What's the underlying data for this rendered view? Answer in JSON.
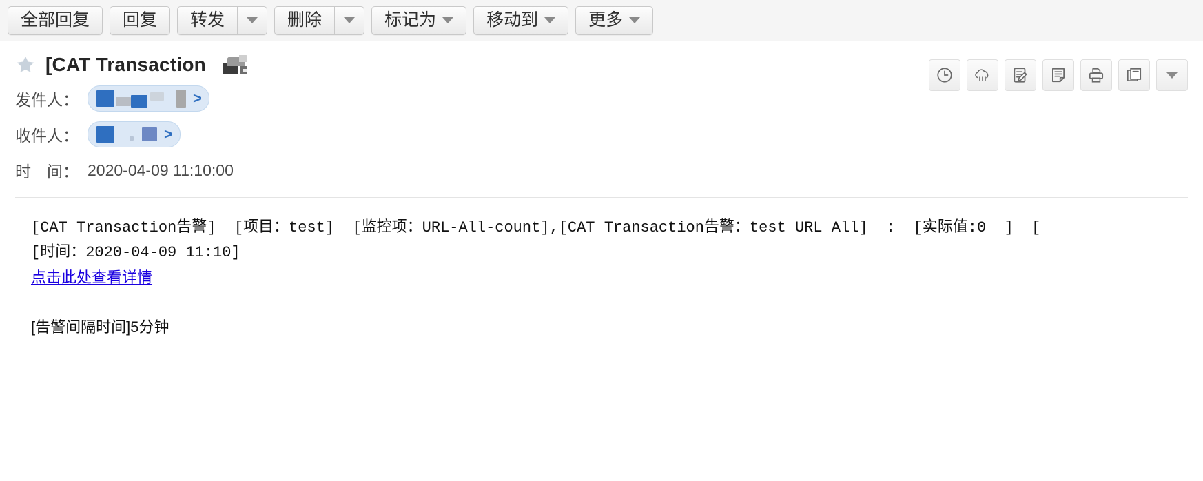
{
  "toolbar": {
    "buttons": [
      {
        "label": "全部回复",
        "has_caret": false,
        "split": false
      },
      {
        "label": "回复",
        "has_caret": false,
        "split": false
      },
      {
        "label": "转发",
        "has_caret": false,
        "split": true
      },
      {
        "label": "删除",
        "has_caret": false,
        "split": true
      },
      {
        "label": "标记为",
        "has_caret": true,
        "split": false
      },
      {
        "label": "移动到",
        "has_caret": true,
        "split": false
      },
      {
        "label": "更多",
        "has_caret": true,
        "split": false
      }
    ]
  },
  "mail": {
    "star_icon": "star-icon",
    "subject": "[CAT Transaction",
    "subject_redacted_image": "redacted-image",
    "from_label": "发件人：",
    "to_label": "收件人：",
    "time_label": "时　间：",
    "time_value": "2020-04-09 11:10:00",
    "chip_arrow": ">"
  },
  "icon_bar": {
    "icons": [
      {
        "name": "clock-icon",
        "title": "clock"
      },
      {
        "name": "cloud-download-icon",
        "title": "cloud"
      },
      {
        "name": "edit-note-icon",
        "title": "edit note"
      },
      {
        "name": "note-icon",
        "title": "note"
      },
      {
        "name": "print-icon",
        "title": "print"
      },
      {
        "name": "copy-icon",
        "title": "copy"
      },
      {
        "name": "chevron-down-icon",
        "title": "more"
      }
    ]
  },
  "body": {
    "line1": "[CAT Transaction告警]  [项目：test]  [监控项：URL-All-count],[CAT Transaction告警：test URL All]  :  [实际值:0  ]  [",
    "line2": "[时间：2020-04-09 11:10]",
    "link_text": "点击此处查看详情",
    "footer": "[告警间隔时间]5分钟"
  },
  "colors": {
    "toolbar_bg": "#f5f5f5",
    "button_border": "#c9c9c9",
    "chip_bg": "#dce8f6",
    "link": "#1a00e0",
    "redact_blue": "#2f6fc0",
    "redact_grey": "#b3b3b3"
  }
}
